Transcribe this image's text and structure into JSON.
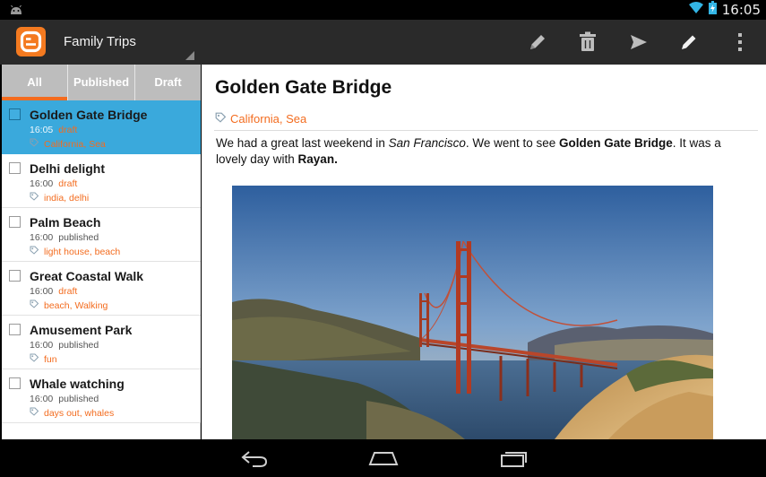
{
  "status_bar": {
    "clock": "16:05"
  },
  "action_bar": {
    "app_icon": "blogger-icon",
    "blog_title": "Family Trips",
    "actions": [
      "edit-icon",
      "delete-icon",
      "publish-icon",
      "new-post-icon",
      "overflow-menu-icon"
    ]
  },
  "tabs": [
    {
      "label": "All"
    },
    {
      "label": "Published"
    },
    {
      "label": "Draft"
    }
  ],
  "posts": [
    {
      "title": "Golden Gate Bridge",
      "time": "16:05",
      "status": "draft",
      "tags": "California, Sea"
    },
    {
      "title": "Delhi delight",
      "time": "16:00",
      "status": "draft",
      "tags": "india, delhi"
    },
    {
      "title": "Palm Beach",
      "time": "16:00",
      "status": "published",
      "tags": "light house, beach"
    },
    {
      "title": "Great Coastal Walk",
      "time": "16:00",
      "status": "draft",
      "tags": "beach, Walking"
    },
    {
      "title": "Amusement Park",
      "time": "16:00",
      "status": "published",
      "tags": "fun"
    },
    {
      "title": "Whale watching",
      "time": "16:00",
      "status": "published",
      "tags": "days out, whales"
    }
  ],
  "content": {
    "title": "Golden Gate Bridge",
    "labels": "California, Sea",
    "body": {
      "p1": "We had a great last weekend in ",
      "place": "San Francisco",
      "p2": ". We went to see ",
      "landmark": "Golden Gate Bridge",
      "p3": ". It was a lovely day with ",
      "person": "Rayan.",
      "p4": ""
    }
  },
  "colors": {
    "accent": "#f36c1f",
    "selected_row": "#3aa9dc",
    "action_bar": "#2a2a2a",
    "tab_bar": "#bdbdbd"
  }
}
